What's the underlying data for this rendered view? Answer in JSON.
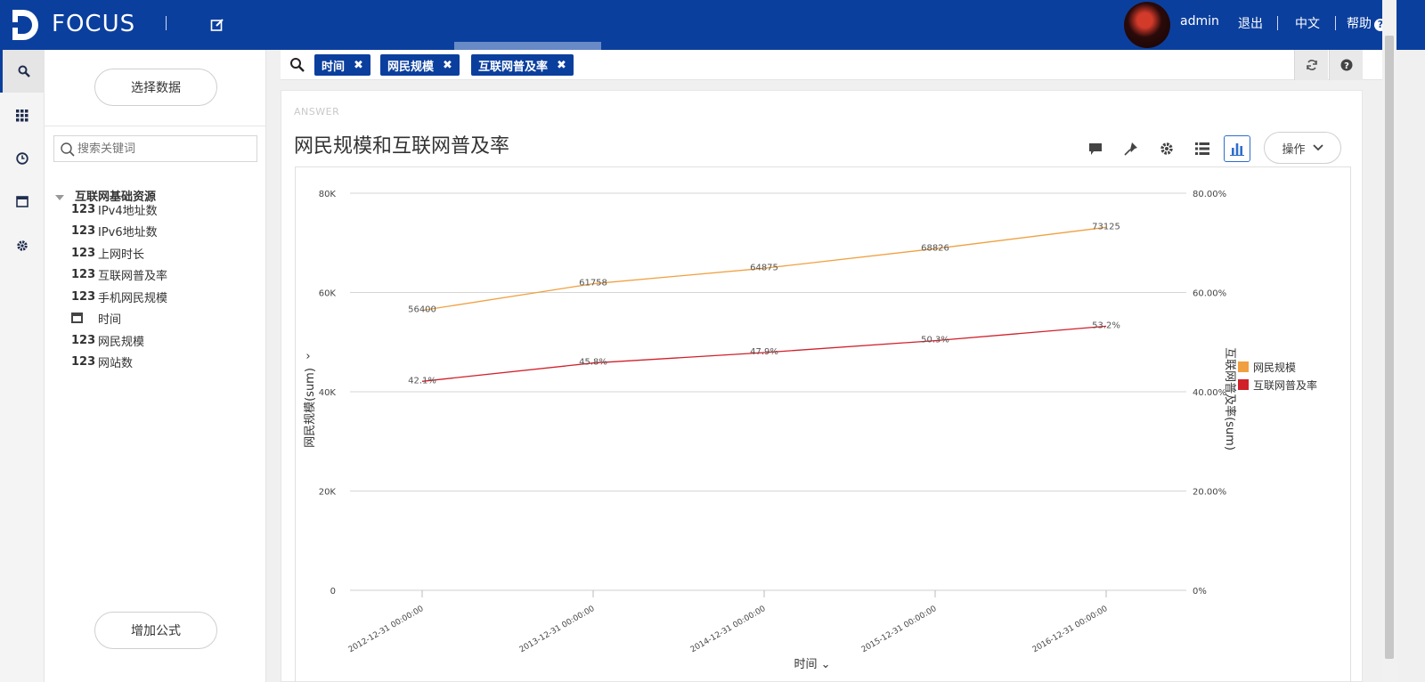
{
  "app": {
    "logo_text": "FOCUS",
    "user_name": "admin",
    "logout_label": "退出",
    "language_label": "中文",
    "help_label": "帮助"
  },
  "panel": {
    "select_data_label": "选择数据",
    "search_placeholder": "搜索关键词",
    "tree_root": "互联网基础资源",
    "fields": [
      {
        "type": "123",
        "label": "IPv4地址数"
      },
      {
        "type": "123",
        "label": "IPv6地址数"
      },
      {
        "type": "123",
        "label": "上网时长"
      },
      {
        "type": "123",
        "label": "互联网普及率"
      },
      {
        "type": "123",
        "label": "手机网民规模"
      },
      {
        "type": "calendar",
        "label": "时间"
      },
      {
        "type": "123",
        "label": "网民规模"
      },
      {
        "type": "123",
        "label": "网站数"
      }
    ],
    "add_formula_label": "增加公式"
  },
  "query": {
    "tokens": [
      "时间",
      "网民规模",
      "互联网普及率"
    ],
    "remove_glyph": "✖"
  },
  "answer": {
    "section_label": "ANSWER",
    "title": "网民规模和互联网普及率",
    "ops_label": "操作"
  },
  "colors": {
    "brand": "#0b3f9e",
    "series_netizen": "#f0a040",
    "series_rate": "#d0202a"
  },
  "chart_data": {
    "type": "line",
    "x_label": "时间",
    "y_left_label": "网民规模(sum)",
    "y_right_label": "互联网普及率(sum)",
    "categories": [
      "2012-12-31 00:00:00",
      "2013-12-31 00:00:00",
      "2014-12-31 00:00:00",
      "2015-12-31 00:00:00",
      "2016-12-31 00:00:00"
    ],
    "y_left_ticks": [
      "0",
      "20K",
      "40K",
      "60K",
      "80K"
    ],
    "y_right_ticks": [
      "0%",
      "20.00%",
      "40.00%",
      "60.00%",
      "80.00%"
    ],
    "y_left_range": [
      0,
      80000
    ],
    "y_right_range": [
      0,
      80
    ],
    "series": [
      {
        "name": "网民规模",
        "axis": "left",
        "values": [
          56400,
          61758,
          64875,
          68826,
          73125
        ],
        "labels": [
          "56400",
          "61758",
          "64875",
          "68826",
          "73125"
        ]
      },
      {
        "name": "互联网普及率",
        "axis": "right",
        "values": [
          42.1,
          45.8,
          47.9,
          50.3,
          53.2
        ],
        "labels": [
          "42.1%",
          "45.8%",
          "47.9%",
          "50.3%",
          "53.2%"
        ]
      }
    ],
    "grid": true,
    "legend_position": "right"
  }
}
